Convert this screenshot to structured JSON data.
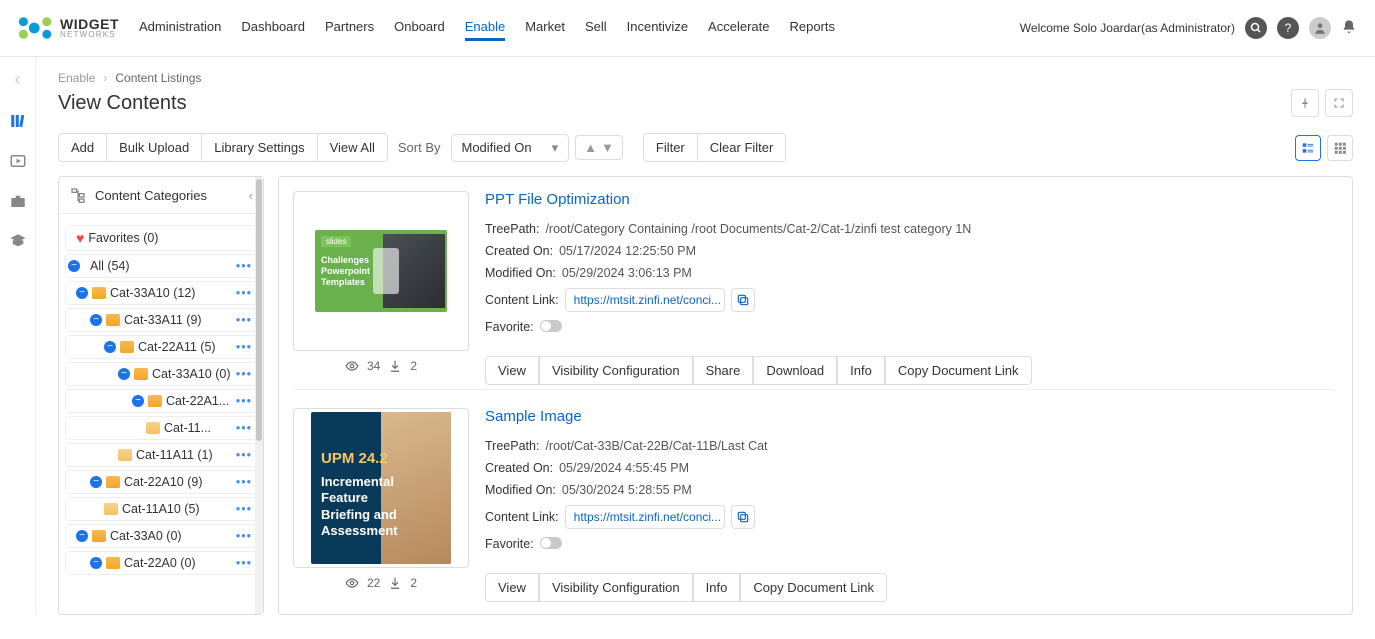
{
  "brand": {
    "name": "WIDGET",
    "sub": "NETWORKS"
  },
  "nav": {
    "items": [
      "Administration",
      "Dashboard",
      "Partners",
      "Onboard",
      "Enable",
      "Market",
      "Sell",
      "Incentivize",
      "Accelerate",
      "Reports"
    ],
    "active_index": 4
  },
  "header": {
    "welcome": "Welcome Solo Joardar(as Administrator)"
  },
  "breadcrumb": {
    "root": "Enable",
    "page": "Content Listings"
  },
  "page_title": "View Contents",
  "toolbar": {
    "add": "Add",
    "bulk": "Bulk Upload",
    "lib": "Library Settings",
    "viewall": "View All",
    "sort_label": "Sort By",
    "sort_value": "Modified On",
    "filter": "Filter",
    "clear": "Clear Filter"
  },
  "tree": {
    "header": "Content Categories",
    "favorites": "Favorites (0)",
    "all": "All (54)",
    "items": [
      {
        "indent": 0,
        "label": "Cat-33A10 (12)",
        "open": true
      },
      {
        "indent": 1,
        "label": "Cat-33A11 (9)",
        "open": true
      },
      {
        "indent": 2,
        "label": "Cat-22A11 (5)",
        "open": true
      },
      {
        "indent": 3,
        "label": "Cat-33A10 (0)",
        "open": true
      },
      {
        "indent": 4,
        "label": "Cat-22A1...",
        "open": true
      },
      {
        "indent": 5,
        "label": "Cat-11...",
        "open": false,
        "leaf": true
      },
      {
        "indent": 3,
        "label": "Cat-11A11 (1)",
        "open": false,
        "leaf": true
      },
      {
        "indent": 1,
        "label": "Cat-22A10 (9)",
        "open": true
      },
      {
        "indent": 2,
        "label": "Cat-11A10 (5)",
        "open": false,
        "leaf": true
      },
      {
        "indent": 0,
        "label": "Cat-33A0 (0)",
        "open": true
      },
      {
        "indent": 1,
        "label": "Cat-22A0 (0)",
        "open": true,
        "cut": true
      }
    ]
  },
  "items": [
    {
      "title": "PPT File Optimization",
      "treepath": "/root/Category Containing /root Documents/Cat-2/Cat-1/zinfi test category 1N",
      "created": "05/17/2024 12:25:50 PM",
      "modified": "05/29/2024 3:06:13 PM",
      "link": "https://mtsit.zinfi.net/conci...",
      "views": "34",
      "downloads": "2",
      "actions": [
        "View",
        "Visibility Configuration",
        "Share",
        "Download",
        "Info",
        "Copy Document Link"
      ],
      "thumb_kind": "ppt",
      "thumb_label": "Challenges Powerpoint Templates"
    },
    {
      "title": "Sample Image",
      "treepath": "/root/Cat-33B/Cat-22B/Cat-11B/Last Cat",
      "created": "05/29/2024 4:55:45 PM",
      "modified": "05/30/2024 5:28:55 PM",
      "link": "https://mtsit.zinfi.net/conci...",
      "views": "22",
      "downloads": "2",
      "actions": [
        "View",
        "Visibility Configuration",
        "Info",
        "Copy Document Link"
      ],
      "thumb_kind": "img",
      "thumb_head": "UPM 24.2",
      "thumb_sub": "Incremental Feature Briefing and Assessment"
    }
  ],
  "meta_labels": {
    "treepath": "TreePath:",
    "created": "Created On:",
    "modified": "Modified On:",
    "link": "Content Link:",
    "fav": "Favorite:"
  }
}
